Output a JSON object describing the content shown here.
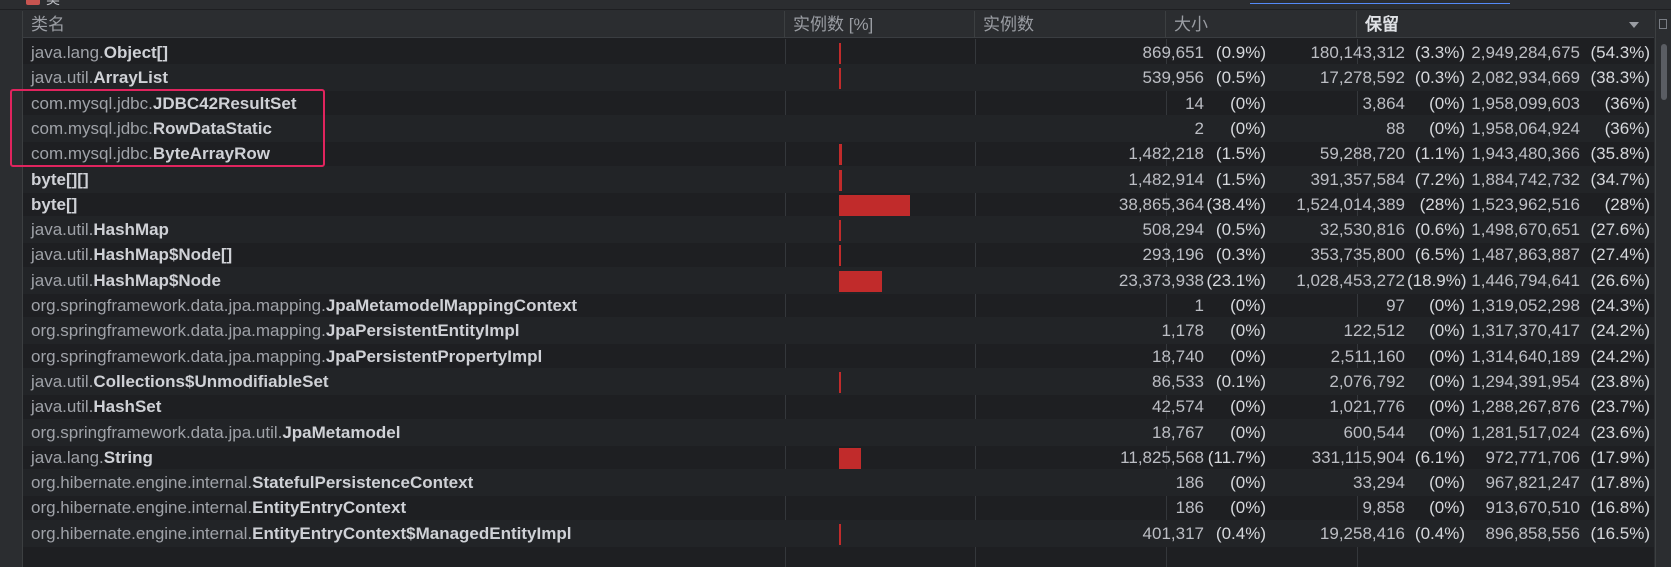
{
  "window": {
    "title": "类"
  },
  "columns": {
    "name": "类名",
    "bar": "实例数 [%]",
    "count": "实例数",
    "size": "大小",
    "retained": "保留"
  },
  "rows": [
    {
      "pkg": "java.lang.",
      "cls": "Object[]",
      "bar_pct": 0.9,
      "count": "869,651",
      "count_pct": "(0.9%)",
      "size": "180,143,312",
      "size_pct": "(3.3%)",
      "retained": "2,949,284,675",
      "retained_pct": "(54.3%)"
    },
    {
      "pkg": "java.util.",
      "cls": "ArrayList",
      "bar_pct": 0.5,
      "count": "539,956",
      "count_pct": "(0.5%)",
      "size": "17,278,592",
      "size_pct": "(0.3%)",
      "retained": "2,082,934,669",
      "retained_pct": "(38.3%)"
    },
    {
      "pkg": "com.mysql.jdbc.",
      "cls": "JDBC42ResultSet",
      "bar_pct": 0,
      "count": "14",
      "count_pct": "(0%)",
      "size": "3,864",
      "size_pct": "(0%)",
      "retained": "1,958,099,603",
      "retained_pct": "(36%)"
    },
    {
      "pkg": "com.mysql.jdbc.",
      "cls": "RowDataStatic",
      "bar_pct": 0,
      "count": "2",
      "count_pct": "(0%)",
      "size": "88",
      "size_pct": "(0%)",
      "retained": "1,958,064,924",
      "retained_pct": "(36%)"
    },
    {
      "pkg": "com.mysql.jdbc.",
      "cls": "ByteArrayRow",
      "bar_pct": 1.5,
      "count": "1,482,218",
      "count_pct": "(1.5%)",
      "size": "59,288,720",
      "size_pct": "(1.1%)",
      "retained": "1,943,480,366",
      "retained_pct": "(35.8%)"
    },
    {
      "pkg": "",
      "cls": "byte[][]",
      "bar_pct": 1.5,
      "count": "1,482,914",
      "count_pct": "(1.5%)",
      "size": "391,357,584",
      "size_pct": "(7.2%)",
      "retained": "1,884,742,732",
      "retained_pct": "(34.7%)"
    },
    {
      "pkg": "",
      "cls": "byte[]",
      "bar_pct": 38.4,
      "count": "38,865,364",
      "count_pct": "(38.4%)",
      "size": "1,524,014,389",
      "size_pct": "(28%)",
      "retained": "1,523,962,516",
      "retained_pct": "(28%)"
    },
    {
      "pkg": "java.util.",
      "cls": "HashMap",
      "bar_pct": 0.5,
      "count": "508,294",
      "count_pct": "(0.5%)",
      "size": "32,530,816",
      "size_pct": "(0.6%)",
      "retained": "1,498,670,651",
      "retained_pct": "(27.6%)"
    },
    {
      "pkg": "java.util.",
      "cls": "HashMap$Node[]",
      "bar_pct": 0.3,
      "count": "293,196",
      "count_pct": "(0.3%)",
      "size": "353,735,800",
      "size_pct": "(6.5%)",
      "retained": "1,487,863,887",
      "retained_pct": "(27.4%)"
    },
    {
      "pkg": "java.util.",
      "cls": "HashMap$Node",
      "bar_pct": 23.1,
      "count": "23,373,938",
      "count_pct": "(23.1%)",
      "size": "1,028,453,272",
      "size_pct": "(18.9%)",
      "retained": "1,446,794,641",
      "retained_pct": "(26.6%)"
    },
    {
      "pkg": "org.springframework.data.jpa.mapping.",
      "cls": "JpaMetamodelMappingContext",
      "bar_pct": 0,
      "count": "1",
      "count_pct": "(0%)",
      "size": "97",
      "size_pct": "(0%)",
      "retained": "1,319,052,298",
      "retained_pct": "(24.3%)"
    },
    {
      "pkg": "org.springframework.data.jpa.mapping.",
      "cls": "JpaPersistentEntityImpl",
      "bar_pct": 0,
      "count": "1,178",
      "count_pct": "(0%)",
      "size": "122,512",
      "size_pct": "(0%)",
      "retained": "1,317,370,417",
      "retained_pct": "(24.2%)"
    },
    {
      "pkg": "org.springframework.data.jpa.mapping.",
      "cls": "JpaPersistentPropertyImpl",
      "bar_pct": 0,
      "count": "18,740",
      "count_pct": "(0%)",
      "size": "2,511,160",
      "size_pct": "(0%)",
      "retained": "1,314,640,189",
      "retained_pct": "(24.2%)"
    },
    {
      "pkg": "java.util.",
      "cls": "Collections$UnmodifiableSet",
      "bar_pct": 0.1,
      "count": "86,533",
      "count_pct": "(0.1%)",
      "size": "2,076,792",
      "size_pct": "(0%)",
      "retained": "1,294,391,954",
      "retained_pct": "(23.8%)"
    },
    {
      "pkg": "java.util.",
      "cls": "HashSet",
      "bar_pct": 0,
      "count": "42,574",
      "count_pct": "(0%)",
      "size": "1,021,776",
      "size_pct": "(0%)",
      "retained": "1,288,267,876",
      "retained_pct": "(23.7%)"
    },
    {
      "pkg": "org.springframework.data.jpa.util.",
      "cls": "JpaMetamodel",
      "bar_pct": 0,
      "count": "18,767",
      "count_pct": "(0%)",
      "size": "600,544",
      "size_pct": "(0%)",
      "retained": "1,281,517,024",
      "retained_pct": "(23.6%)"
    },
    {
      "pkg": "java.lang.",
      "cls": "String",
      "bar_pct": 11.7,
      "count": "11,825,568",
      "count_pct": "(11.7%)",
      "size": "331,115,904",
      "size_pct": "(6.1%)",
      "retained": "972,771,706",
      "retained_pct": "(17.9%)"
    },
    {
      "pkg": "org.hibernate.engine.internal.",
      "cls": "StatefulPersistenceContext",
      "bar_pct": 0,
      "count": "186",
      "count_pct": "(0%)",
      "size": "33,294",
      "size_pct": "(0%)",
      "retained": "967,821,247",
      "retained_pct": "(17.8%)"
    },
    {
      "pkg": "org.hibernate.engine.internal.",
      "cls": "EntityEntryContext",
      "bar_pct": 0,
      "count": "186",
      "count_pct": "(0%)",
      "size": "9,858",
      "size_pct": "(0%)",
      "retained": "913,670,510",
      "retained_pct": "(16.8%)"
    },
    {
      "pkg": "org.hibernate.engine.internal.",
      "cls": "EntityEntryContext$ManagedEntityImpl",
      "bar_pct": 0.4,
      "count": "401,317",
      "count_pct": "(0.4%)",
      "size": "19,258,416",
      "size_pct": "(0.4%)",
      "retained": "896,858,556",
      "retained_pct": "(16.5%)"
    }
  ],
  "colors": {
    "bar": "#c12b2b",
    "highlight": "#e0245e",
    "background": "#1e1f22"
  }
}
